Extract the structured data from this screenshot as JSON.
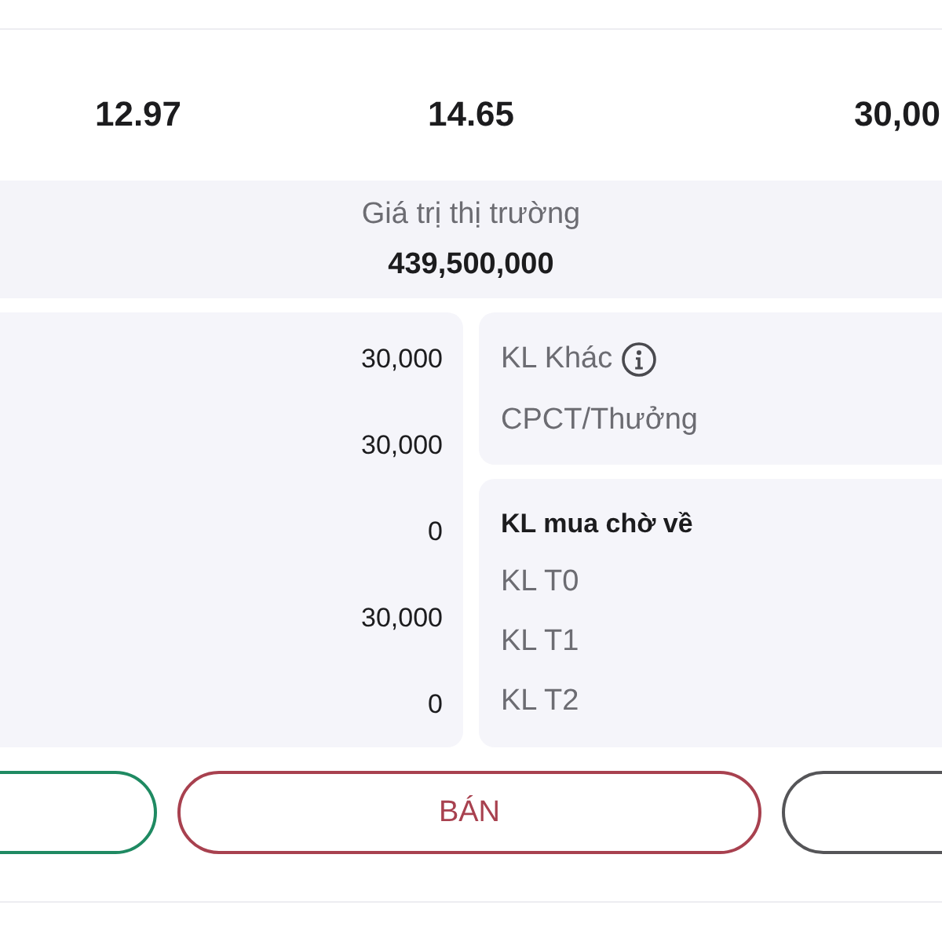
{
  "summary_values": [
    "12.97",
    "14.65",
    "30,00"
  ],
  "market_value": {
    "label": "Giá trị thị trường",
    "value": "439,500,000"
  },
  "quantity_values": [
    "30,000",
    "30,000",
    "0",
    "30,000",
    "0"
  ],
  "other_panel": {
    "rows": [
      {
        "label": "KL Khác",
        "has_info": true
      },
      {
        "label": "CPCT/Thưởng",
        "has_info": false
      }
    ]
  },
  "pending_panel": {
    "title": "KL mua chờ về",
    "rows": [
      "KL T0",
      "KL T1",
      "KL T2"
    ]
  },
  "buttons": [
    {
      "color": "#1f8a62"
    },
    {
      "label": "BÁN",
      "color": "#a8414f"
    },
    {
      "color": "#555558"
    }
  ]
}
